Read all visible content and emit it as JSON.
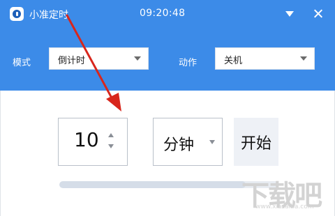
{
  "window": {
    "title": "小准定时",
    "clock": "09:20:48",
    "controls": [
      "minimize",
      "close"
    ]
  },
  "settings": {
    "mode_label": "模式",
    "mode_value": "倒计时",
    "action_label": "动作",
    "action_value": "关机"
  },
  "timer": {
    "number": "10",
    "unit": "分钟",
    "start_label": "开始",
    "progress_fraction": 0.85
  },
  "icons": [
    "app-logo-icon",
    "minimize-icon",
    "close-icon",
    "dropdown-arrow-icon",
    "spin-up-icon",
    "spin-down-icon"
  ],
  "colors": {
    "accent": "#3c8be8",
    "annotation": "#d8261c"
  },
  "watermark": {
    "text": "下载吧",
    "url": "www.xiazaiba.com"
  }
}
